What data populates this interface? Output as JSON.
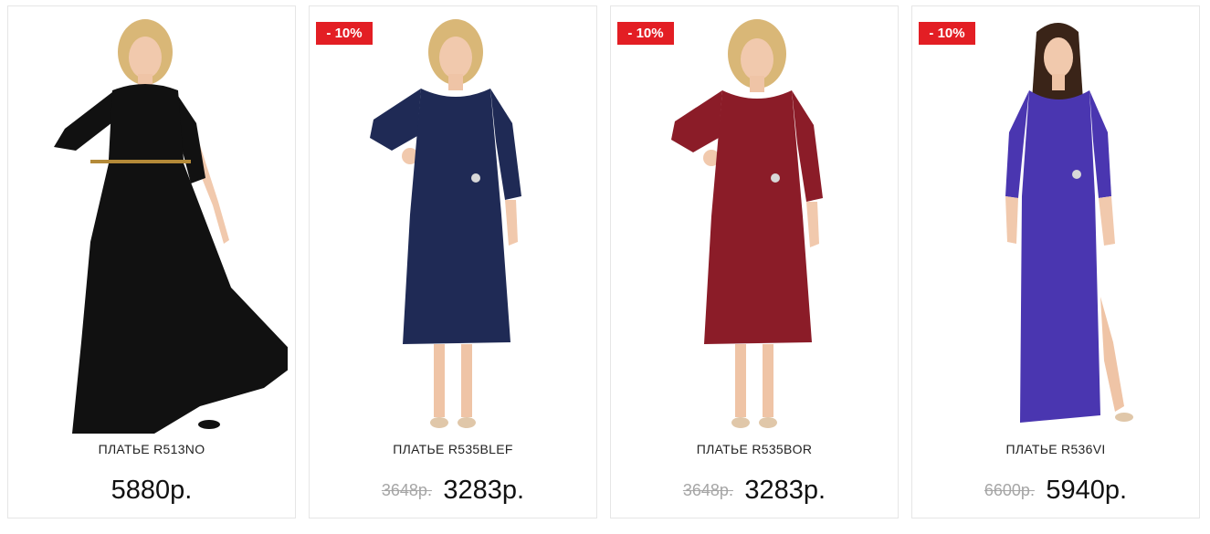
{
  "products": [
    {
      "name": "ПЛАТЬЕ R513NO",
      "badge": "",
      "old_price": "",
      "price": "5880р.",
      "dress_color": "#111111",
      "dress_style": "maxi-flared"
    },
    {
      "name": "ПЛАТЬЕ R535BLEF",
      "badge": "- 10%",
      "old_price": "3648р.",
      "price": "3283р.",
      "dress_color": "#1f2a55",
      "dress_style": "midi-wrap"
    },
    {
      "name": "ПЛАТЬЕ R535BOR",
      "badge": "- 10%",
      "old_price": "3648р.",
      "price": "3283р.",
      "dress_color": "#8b1c28",
      "dress_style": "midi-wrap"
    },
    {
      "name": "ПЛАТЬЕ R536VI",
      "badge": "- 10%",
      "old_price": "6600р.",
      "price": "5940р.",
      "dress_color": "#4a36b0",
      "dress_style": "maxi-slit"
    }
  ],
  "colors": {
    "badge_bg": "#e31e24",
    "old_price": "#a6a6a6",
    "card_border": "#e6e6e6"
  }
}
